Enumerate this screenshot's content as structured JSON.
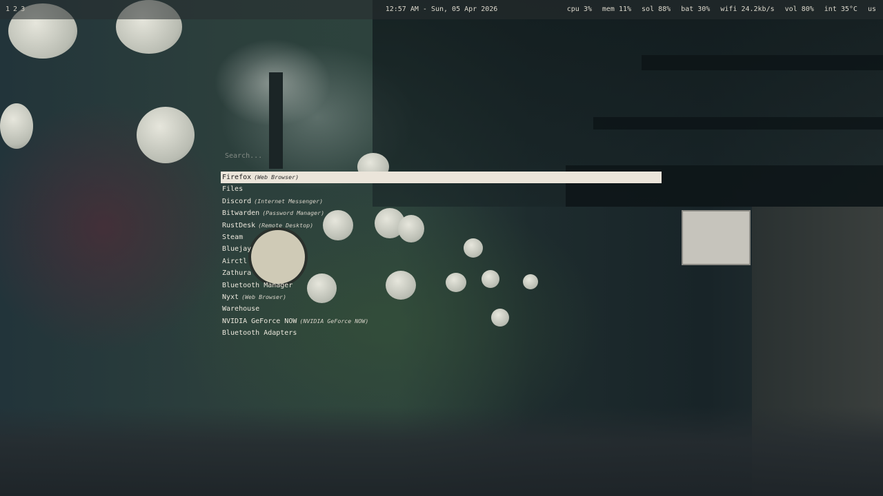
{
  "topbar": {
    "workspaces": [
      "1",
      "2",
      "3"
    ],
    "clock": "12:57 AM - Sun, 05 Apr 2026",
    "status": {
      "cpu": "cpu 3%",
      "mem": "mem 11%",
      "sol": "sol 88%",
      "bat": "bat 30%",
      "wifi": "wifi 24.2kb/s",
      "vol": "vol 80%",
      "int": "int 35°C",
      "layout": "us"
    }
  },
  "launcher": {
    "search_placeholder": "Search...",
    "search_value": "",
    "selected_index": 0,
    "results": [
      {
        "name": "Firefox",
        "desc": "(Web Browser)"
      },
      {
        "name": "Files",
        "desc": ""
      },
      {
        "name": "Discord",
        "desc": "(Internet Messenger)"
      },
      {
        "name": "Bitwarden",
        "desc": "(Password Manager)"
      },
      {
        "name": "RustDesk",
        "desc": "(Remote Desktop)"
      },
      {
        "name": "Steam",
        "desc": ""
      },
      {
        "name": "Bluejay",
        "desc": ""
      },
      {
        "name": "Airctl",
        "desc": ""
      },
      {
        "name": "Zathura",
        "desc": ""
      },
      {
        "name": "Bluetooth Manager",
        "desc": ""
      },
      {
        "name": "Nyxt",
        "desc": "(Web Browser)"
      },
      {
        "name": "Warehouse",
        "desc": ""
      },
      {
        "name": "NVIDIA GeForce NOW",
        "desc": "(NVIDIA GeForce NOW)"
      },
      {
        "name": "Bluetooth Adapters",
        "desc": ""
      }
    ]
  },
  "colors": {
    "selection_bg": "#ebe5da",
    "text": "#e6e1d6"
  }
}
